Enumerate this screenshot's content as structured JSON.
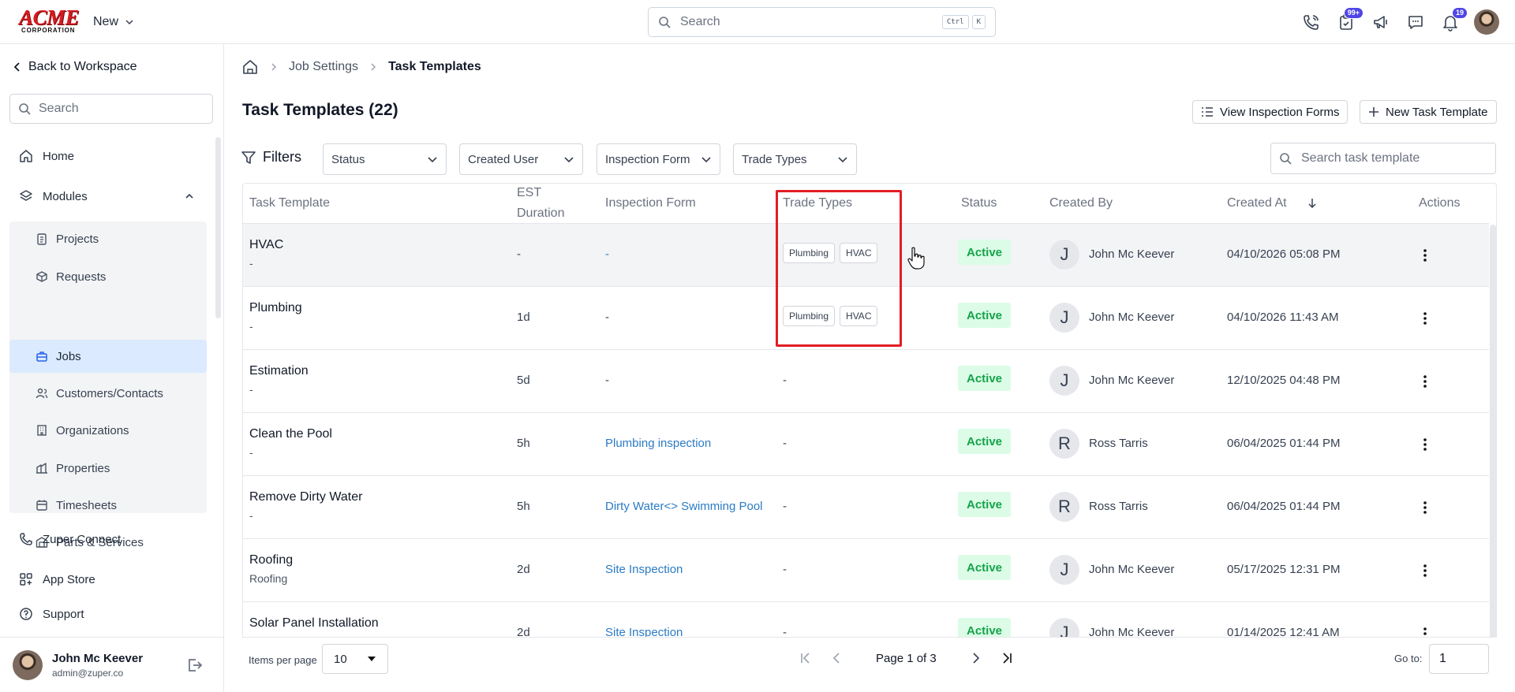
{
  "header": {
    "logo_text": "ACME",
    "logo_sub": "CORPORATION",
    "new_label": "New",
    "search_placeholder": "Search",
    "shortcut_ctrl": "Ctrl",
    "shortcut_key": "K",
    "tasks_badge": "99+",
    "notifications_badge": "19"
  },
  "sidebar": {
    "back_label": "Back to Workspace",
    "search_placeholder": "Search",
    "home_label": "Home",
    "modules_label": "Modules",
    "modules_items": [
      {
        "label": "Projects",
        "icon": "clipboard-icon"
      },
      {
        "label": "Requests",
        "icon": "box-icon"
      },
      {
        "label": "Jobs",
        "icon": "briefcase-icon",
        "active": true
      },
      {
        "label": "Customers/Contacts",
        "icon": "users-icon"
      },
      {
        "label": "Organizations",
        "icon": "building-icon"
      },
      {
        "label": "Properties",
        "icon": "property-icon"
      },
      {
        "label": "Timesheets",
        "icon": "calendar-icon"
      },
      {
        "label": "Parts & Services",
        "icon": "warehouse-icon"
      }
    ],
    "bottom_items": [
      {
        "label": "Zuper Connect",
        "icon": "phone-icon"
      },
      {
        "label": "App Store",
        "icon": "grid-icon"
      },
      {
        "label": "Support",
        "icon": "help-icon"
      }
    ],
    "user": {
      "name": "John Mc Keever",
      "email": "admin@zuper.co"
    }
  },
  "breadcrumb": {
    "level1": "Job Settings",
    "level2": "Task Templates"
  },
  "page": {
    "title": "Task Templates (22)",
    "view_forms_label": "View Inspection Forms",
    "new_template_label": "New Task Template"
  },
  "filters": {
    "label": "Filters",
    "status": "Status",
    "created_user": "Created User",
    "inspection_form": "Inspection Form",
    "trade_types": "Trade Types",
    "search_placeholder": "Search task template"
  },
  "table": {
    "headers": {
      "task_template": "Task Template",
      "est_duration_1": "EST",
      "est_duration_2": "Duration",
      "inspection_form": "Inspection Form",
      "trade_types": "Trade Types",
      "status": "Status",
      "created_by": "Created By",
      "created_at": "Created At",
      "actions": "Actions"
    },
    "rows": [
      {
        "name": "HVAC",
        "sub": "-",
        "duration": "-",
        "form": "-",
        "trade_types": [
          "Plumbing",
          "HVAC"
        ],
        "status": "Active",
        "initial": "J",
        "created_by": "John Mc Keever",
        "created_at": "04/10/2026 05:08 PM"
      },
      {
        "name": "Plumbing",
        "sub": "-",
        "duration": "1d",
        "form": "-",
        "trade_types": [
          "Plumbing",
          "HVAC"
        ],
        "status": "Active",
        "initial": "J",
        "created_by": "John Mc Keever",
        "created_at": "04/10/2026 11:43 AM"
      },
      {
        "name": "Estimation",
        "sub": "-",
        "duration": "5d",
        "form": "-",
        "trade_none": "-",
        "status": "Active",
        "initial": "J",
        "created_by": "John Mc Keever",
        "created_at": "12/10/2025 04:48 PM"
      },
      {
        "name": "Clean the Pool",
        "sub": "-",
        "duration": "5h",
        "form": "Plumbing inspection",
        "trade_none": "-",
        "status": "Active",
        "initial": "R",
        "created_by": "Ross Tarris",
        "created_at": "06/04/2025 01:44 PM"
      },
      {
        "name": "Remove Dirty Water",
        "sub": "-",
        "duration": "5h",
        "form": "Dirty Water<> Swimming Pool",
        "trade_none": "-",
        "status": "Active",
        "initial": "R",
        "created_by": "Ross Tarris",
        "created_at": "06/04/2025 01:44 PM"
      },
      {
        "name": "Roofing",
        "sub": "Roofing",
        "duration": "2d",
        "form": "Site Inspection",
        "trade_none": "-",
        "status": "Active",
        "initial": "J",
        "created_by": "John Mc Keever",
        "created_at": "05/17/2025 12:31 PM"
      },
      {
        "name": "Solar Panel Installation",
        "sub": "",
        "duration": "2d",
        "form": "Site Inspection",
        "trade_none": "-",
        "status": "Active",
        "initial": "J",
        "created_by": "John Mc Keever",
        "created_at": "01/14/2025 12:41 AM"
      }
    ]
  },
  "pagination": {
    "items_per_page_label": "Items per page",
    "items_per_page": "10",
    "page_text": "Page 1 of 3",
    "goto_label": "Go to:",
    "goto_value": "1"
  },
  "colors": {
    "highlight": "#e11d24",
    "active_green": "#16a34a",
    "link_blue": "#2b7bc4",
    "badge_indigo": "#4f46e5"
  }
}
